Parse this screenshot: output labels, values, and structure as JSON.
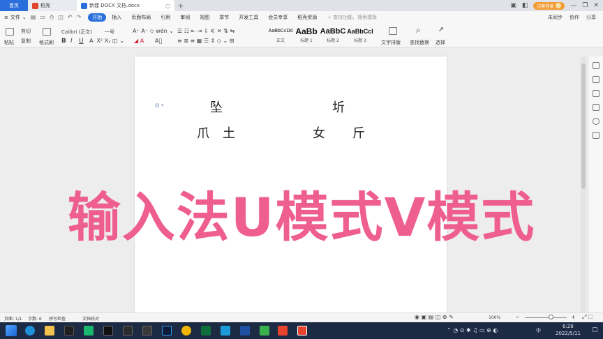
{
  "tabbar": {
    "home_label": "首页",
    "draft_label": "稻壳",
    "doc_label": "新建 DOCX 文档.docx",
    "add_label": "+",
    "login_label": "访客登录"
  },
  "menubar": {
    "file_label": "文件",
    "items": [
      "开始",
      "插入",
      "页面布局",
      "引用",
      "审阅",
      "视图",
      "章节",
      "开发工具",
      "会员专享",
      "稻壳资源"
    ],
    "search_placeholder": "查找功能、搜索模板",
    "right_items": [
      "未同步",
      "协作",
      "分享"
    ]
  },
  "ribbon": {
    "paste_label": "粘贴",
    "cut_label": "剪切",
    "copy_label": "复制",
    "format_painter_label": "格式刷",
    "font_name": "Calibri (正文)",
    "font_size": "一号",
    "styles": [
      {
        "sample": "AaBbCcDd",
        "label": "正文"
      },
      {
        "sample": "AaBb",
        "label": "标题 1"
      },
      {
        "sample": "AaBbC",
        "label": "标题 2"
      },
      {
        "sample": "AaBbCcI",
        "label": "标题 3"
      }
    ],
    "text_layout_label": "文字排版",
    "find_replace_label": "查找替换",
    "select_label": "选择"
  },
  "document": {
    "row1_left": "坠",
    "row1_right": "圻",
    "row2": [
      "爪",
      "土",
      "女",
      "斤"
    ]
  },
  "overlay_title": "输入法U模式V模式",
  "statusbar": {
    "page": "页面: 1/1",
    "words": "字数: 6",
    "spellcheck": "拼写检查",
    "proofread": "文档校对",
    "zoom": "100%"
  },
  "taskbar": {
    "time": "6:28",
    "date": "2022/5/11",
    "ime_label": "中"
  },
  "colors": {
    "accent": "#2a6fdb",
    "overlay": "#ee5e8e",
    "taskbar": "#1d2a44",
    "login": "#f39c35"
  }
}
